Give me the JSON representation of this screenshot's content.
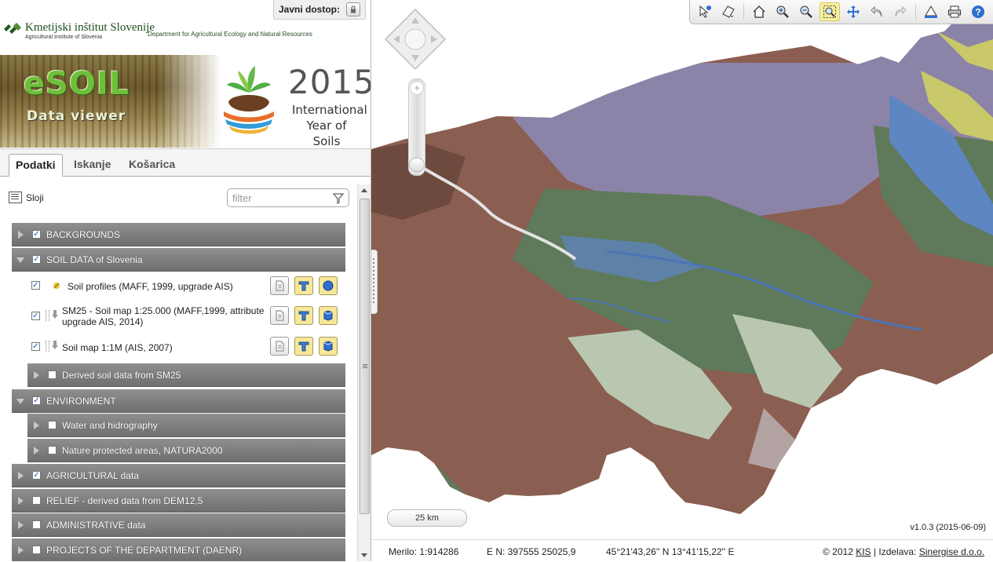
{
  "access": {
    "label": "Javni dostop:",
    "icon": "lock-icon"
  },
  "header": {
    "institute_name": "Kmetijski inštitut Slovenije",
    "institute_name_en": "Agricultural Institute of Slovenia",
    "department": "Department for Agricultural Ecology and Natural Resources",
    "app_title": "eSOIL",
    "app_subtitle": "Data viewer",
    "iys_year": "2015",
    "iys_line1": "International",
    "iys_line2": "Year of Soils"
  },
  "tabs": [
    {
      "label": "Podatki",
      "active": true
    },
    {
      "label": "Iskanje",
      "active": false
    },
    {
      "label": "Košarica",
      "active": false
    }
  ],
  "layers_panel": {
    "title": "Sloji",
    "filter_placeholder": "filter"
  },
  "tree": {
    "backgrounds": {
      "label": "BACKGROUNDS",
      "checked": true,
      "expanded": false
    },
    "soil_data": {
      "label": "SOIL DATA of Slovenia",
      "checked": true,
      "expanded": true
    },
    "soil_profiles": {
      "label": "Soil profiles (MAFF, 1999, upgrade AIS)",
      "checked": true
    },
    "sm25": {
      "label_line1": "SM25 - Soil map 1:25.000 (MAFF,1999, attribute",
      "label_line2": "upgrade AIS, 2014)",
      "checked": true
    },
    "soil_1m": {
      "label": "Soil map 1:1M (AIS, 2007)",
      "checked": true
    },
    "derived": {
      "label": "Derived soil data from SM25",
      "checked": false,
      "expanded": false
    },
    "environment": {
      "label": "ENVIRONMENT",
      "checked": true,
      "expanded": true
    },
    "water": {
      "label": "Water and hidrography",
      "checked": false,
      "expanded": false
    },
    "nature": {
      "label": "Nature protected areas, NATURA2000",
      "checked": false,
      "expanded": false
    },
    "agricultural": {
      "label": "AGRICULTURAL data",
      "checked": true,
      "expanded": false
    },
    "relief": {
      "label": "RELIEF - derived data from DEM12,5",
      "checked": false,
      "expanded": false
    },
    "administrative": {
      "label": "ADMINISTRATIVE data",
      "checked": false,
      "expanded": false
    },
    "projects": {
      "label": "PROJECTS OF THE DEPARTMENT (DAENR)",
      "checked": false,
      "expanded": false
    }
  },
  "toolbar": {
    "tools": [
      "info-cursor-icon",
      "measure-icon",
      "home-extent-icon",
      "zoom-in-icon",
      "zoom-out-icon",
      "zoom-box-icon",
      "pan-icon",
      "undo-icon",
      "redo-icon",
      "ruler-icon",
      "print-icon",
      "help-icon"
    ],
    "active_tool": "zoom-box-icon"
  },
  "map": {
    "scale_bar_label": "25 km",
    "version": "v1.0.3 (2015-06-09)"
  },
  "status": {
    "scale": "Merilo: 1:914286",
    "coords_en": "E N: 397555 25025,9",
    "coords_geo": "45°21'43,26'' N 13°41'15,22'' E",
    "copyright_prefix": "© 2012",
    "kis_link": "KIS",
    "made_by_prefix": "| Izdelava:",
    "sinergise_link": "Sinergise d.o.o."
  },
  "colors": {
    "brown": "#8a5e50",
    "green": "#5f7a5a",
    "purple": "#8c83a8",
    "blue": "#5e86c2",
    "light": "#b9c7b0",
    "yellow": "#c9c96a"
  }
}
